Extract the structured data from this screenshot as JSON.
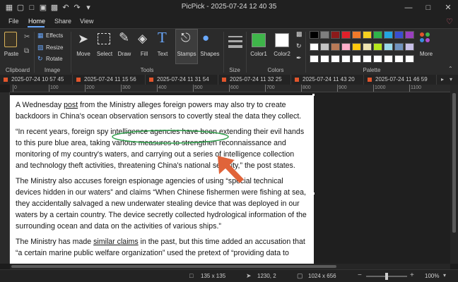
{
  "window": {
    "title": "PicPick - 2025-07-24 12 40 35"
  },
  "menu": {
    "items": [
      "File",
      "Home",
      "Share",
      "View"
    ]
  },
  "ribbon": {
    "clipboard": {
      "paste": "Paste",
      "group": "Clipboard"
    },
    "image": {
      "effects": "Effects",
      "resize": "Resize",
      "rotate": "Rotate",
      "group": "Image"
    },
    "tools": {
      "move": "Move",
      "select": "Select",
      "draw": "Draw",
      "fill": "Fill",
      "text": "Text",
      "stamps": "Stamps",
      "shapes": "Shapes",
      "group": "Tools"
    },
    "size": {
      "group": "Size"
    },
    "colors": {
      "color1": "Color1",
      "color2": "Color2",
      "group": "Colors",
      "color1_value": "#3fb54a",
      "color2_value": "#ffffff"
    },
    "palette": {
      "group": "Palette",
      "more": "More",
      "row1": [
        "#000000",
        "#7f7f7f",
        "#8c1a1a",
        "#e0202a",
        "#f07a2a",
        "#f5d020",
        "#2fb34a",
        "#23a4e0",
        "#3a4ed0",
        "#9a3fc0"
      ],
      "row2": [
        "#ffffff",
        "#c3c3c3",
        "#b97a57",
        "#ffaec9",
        "#ffc90e",
        "#efe4b0",
        "#b5e61d",
        "#99d9ea",
        "#7092be",
        "#c8bfe7"
      ],
      "row3": [
        "#ffffff",
        "#ffffff",
        "#ffffff",
        "#ffffff",
        "#ffffff",
        "#ffffff",
        "#ffffff",
        "#ffffff",
        "#ffffff",
        "#ffffff"
      ]
    }
  },
  "tabs": [
    "2025-07-24 10 57 45",
    "2025-07-24 11 15 56",
    "2025-07-24 11 31 54",
    "2025-07-24 11 32 25",
    "2025-07-24 11 43 20",
    "2025-07-24 11 46 59"
  ],
  "ruler": {
    "labels": [
      "0",
      "100",
      "200",
      "300",
      "400",
      "500",
      "600",
      "700",
      "800",
      "900",
      "1000",
      "1100"
    ]
  },
  "document": {
    "p1_a": "A Wednesday ",
    "p1_link": "post",
    "p1_b": " from the Ministry alleges foreign powers may also try to create backdoors in China's ocean observation sensors to covertly steal the data they collect.",
    "p2": "“In recent years, foreign spy intelligence agencies have been extending their evil hands to this pure blue area, taking various measures to strengthen reconnaissance and monitoring of my country's waters, and carrying out a series of intelligence collection and technology theft activities, threatening China's national security,” the post states.",
    "p3": "The Ministry also accuses foreign espionage agencies of using “special technical devices hidden in our waters” and claims “When Chinese fishermen were fishing at sea, they accidentally salvaged a new underwater stealing device that was deployed in our waters by a certain country. The device secretly collected hydrological information of the surrounding ocean and data on the activities of various ships.”",
    "p4_a": "The Ministry has made ",
    "p4_link": "similar claims",
    "p4_b": " in the past, but this time added an accusation that “a certain marine public welfare organization” used the pretext of “providing data to"
  },
  "annotation": {
    "ellipse_color": "#2e9e4a",
    "arrow_color": "#e0643a"
  },
  "status": {
    "selection": "135 x 135",
    "cursor": "1230, 2",
    "image_size": "1024 x 656",
    "zoom": "100%"
  }
}
